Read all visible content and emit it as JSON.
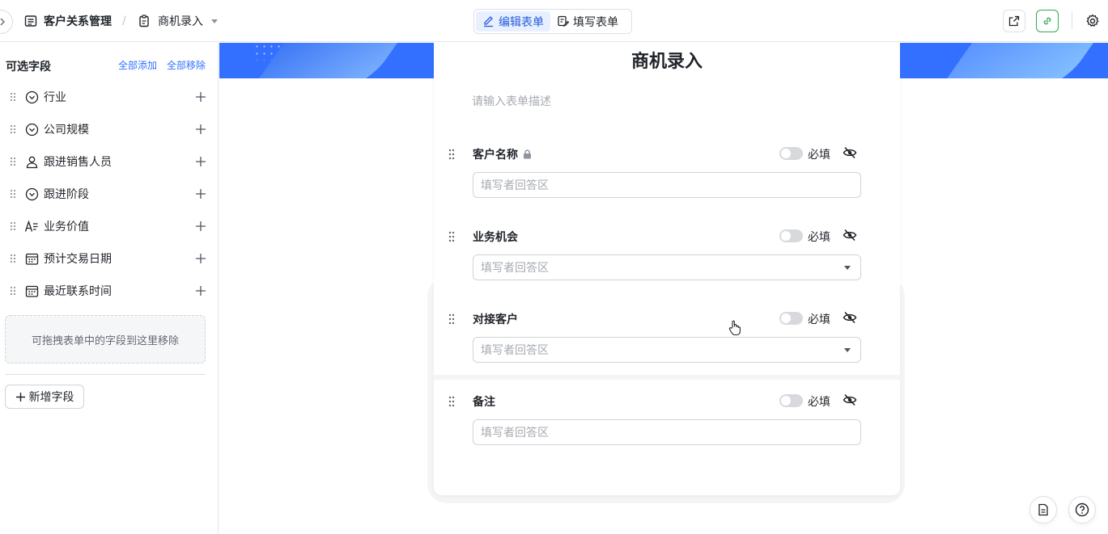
{
  "topbar": {
    "app_name": "客户关系管理",
    "separator": "/",
    "form_name": "商机录入",
    "modes": [
      {
        "label": "编辑表单",
        "active": true
      },
      {
        "label": "填写表单",
        "active": false
      }
    ],
    "icons": {
      "expand": "chevron-right-icon",
      "app": "table-icon",
      "form": "form-icon",
      "share": "external-link-icon",
      "link": "link-icon",
      "settings": "gear-icon"
    }
  },
  "sidebar": {
    "title": "可选字段",
    "add_all": "全部添加",
    "remove_all": "全部移除",
    "fields": [
      {
        "label": "行业",
        "icon": "single-select-icon"
      },
      {
        "label": "公司规模",
        "icon": "single-select-icon"
      },
      {
        "label": "跟进销售人员",
        "icon": "person-icon"
      },
      {
        "label": "跟进阶段",
        "icon": "single-select-icon"
      },
      {
        "label": "业务价值",
        "icon": "text-icon"
      },
      {
        "label": "预计交易日期",
        "icon": "date-icon"
      },
      {
        "label": "最近联系时间",
        "icon": "date-icon"
      }
    ],
    "drop_hint": "可拖拽表单中的字段到这里移除",
    "new_field": "新增字段"
  },
  "form": {
    "title": "商机录入",
    "description_placeholder": "请输入表单描述",
    "required_label": "必填",
    "questions": [
      {
        "label": "客户名称",
        "placeholder": "填写者回答区",
        "locked": true,
        "dropdown": false,
        "required": false
      },
      {
        "label": "业务机会",
        "placeholder": "填写者回答区",
        "locked": false,
        "dropdown": true,
        "required": false
      },
      {
        "label": "对接客户",
        "placeholder": "填写者回答区",
        "locked": false,
        "dropdown": true,
        "required": false
      },
      {
        "label": "备注",
        "placeholder": "填写者回答区",
        "locked": false,
        "dropdown": false,
        "required": false
      }
    ]
  },
  "floating": {
    "doc_icon": "document-icon",
    "help_icon": "help-icon"
  },
  "colors": {
    "accent": "#3370ff",
    "active_bg": "#e8f0ff",
    "link_border": "#34a853"
  }
}
